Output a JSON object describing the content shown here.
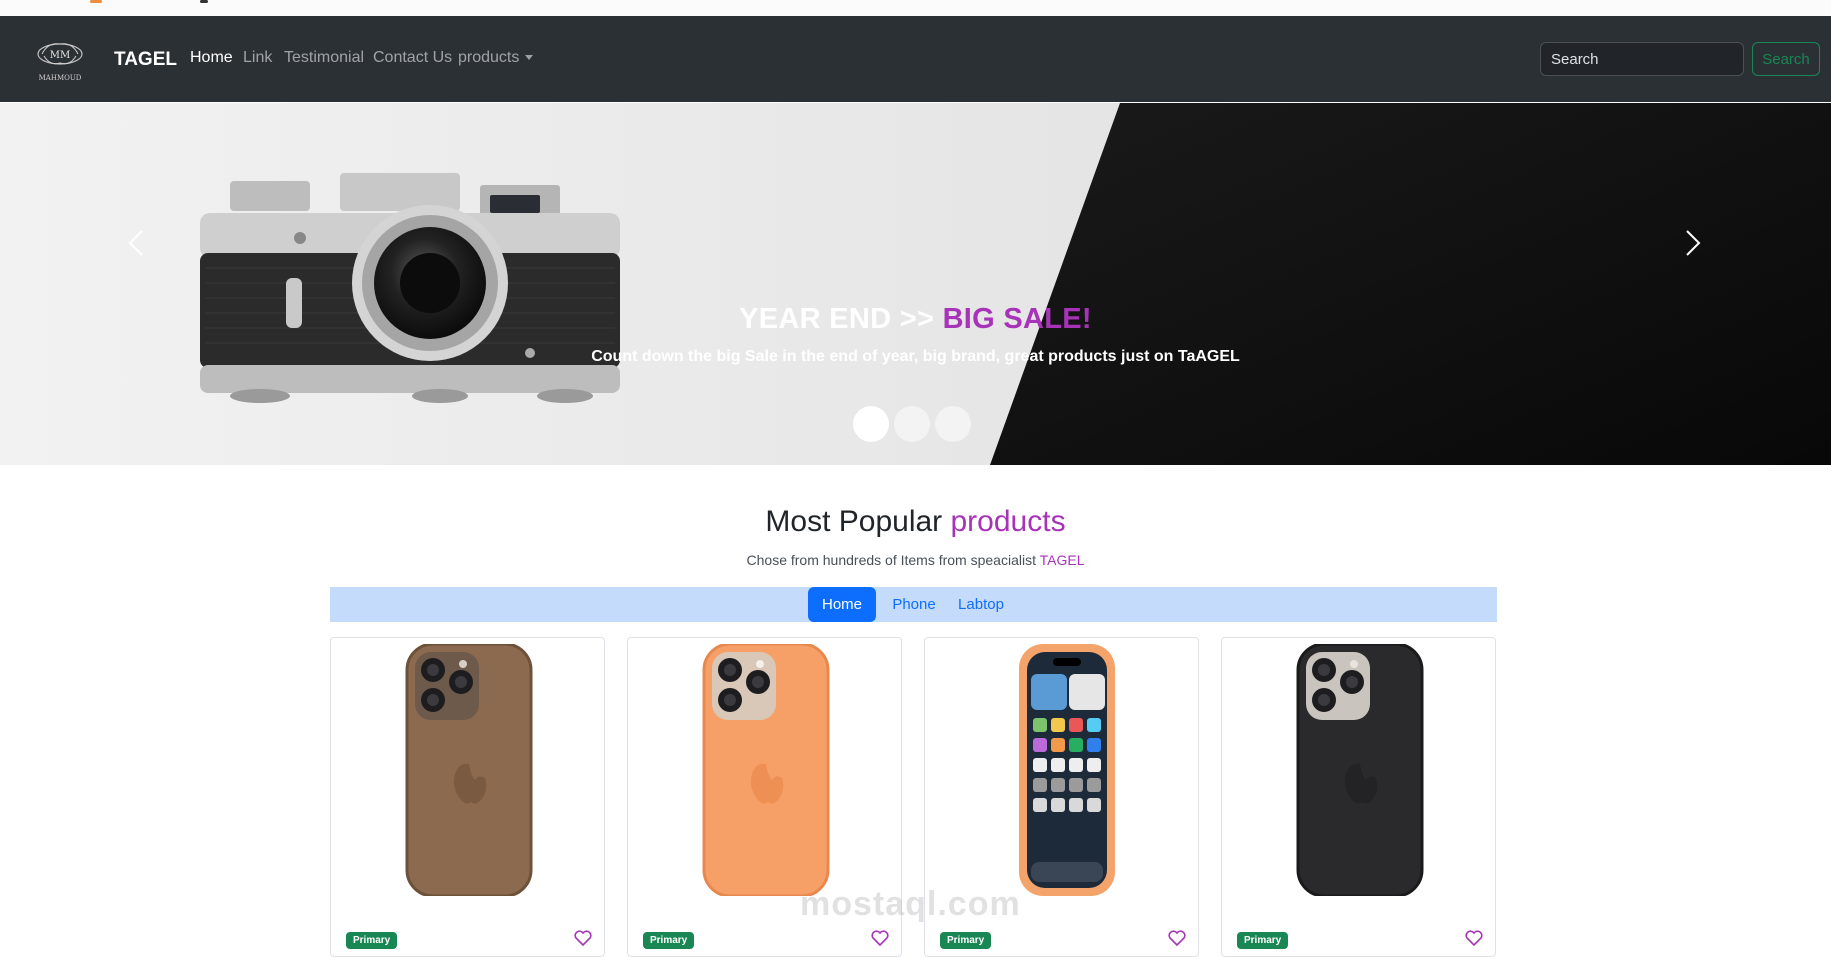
{
  "brand": {
    "logo_text": "MAHMOUD",
    "name": "TAGEL"
  },
  "nav": {
    "links": [
      "Home",
      "Link",
      "Testimonial",
      "Contact Us"
    ],
    "dropdown_label": "products",
    "search_placeholder": "Search",
    "search_button": "Search"
  },
  "hero": {
    "title_main": "YEAR END >> ",
    "title_accent": "BIG SALE!",
    "subtitle": "Count down the big Sale in the end of year, big brand, great products just on TaAGEL",
    "slide_count": 3,
    "active_slide": 1
  },
  "section": {
    "title_main": "Most Popular ",
    "title_accent": "products",
    "subtitle_main": "Chose from hundreds of Items from speacialist ",
    "subtitle_accent": "TAGEL"
  },
  "tabs": [
    "Home",
    "Phone",
    "Labtop"
  ],
  "active_tab": "Home",
  "cards": [
    {
      "badge": "Primary",
      "case_color": "#8b6a4f"
    },
    {
      "badge": "Primary",
      "case_color": "#f6a068"
    },
    {
      "badge": "Primary",
      "case_color": "#f4a36a"
    },
    {
      "badge": "Primary",
      "case_color": "#2a2a2c"
    }
  ],
  "watermark": "mostaql.com",
  "colors": {
    "accent": "#a733b8",
    "navbar": "#2b3035",
    "primary": "#0d6efd",
    "success": "#198754"
  }
}
